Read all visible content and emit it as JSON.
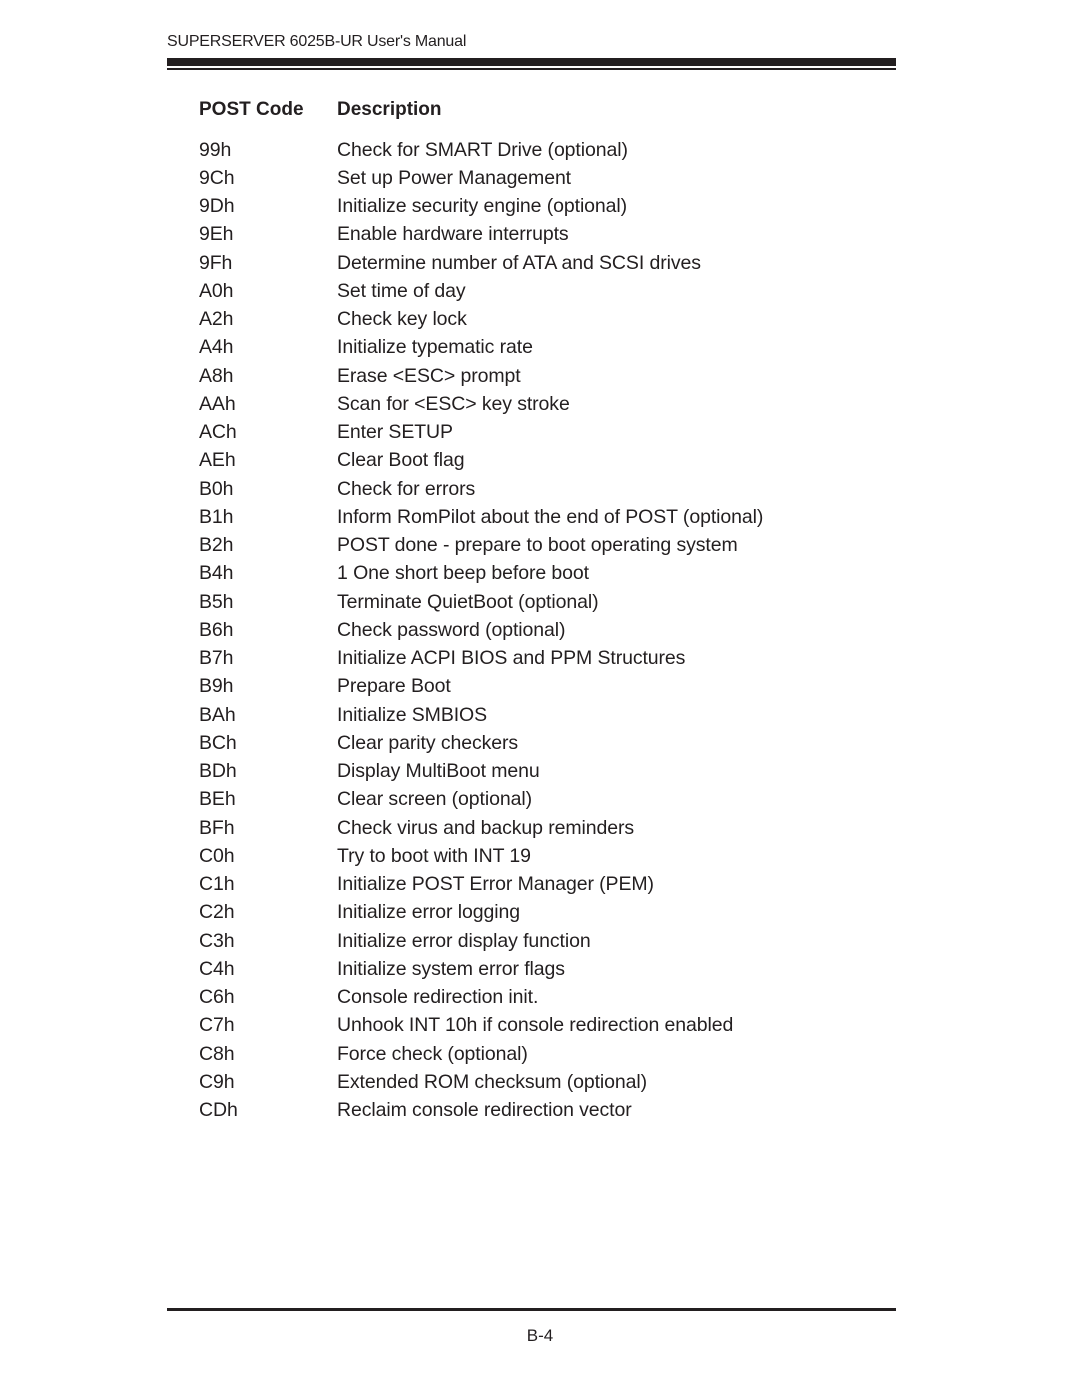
{
  "header": {
    "running_title": "SUPERSERVER 6025B-UR User's Manual"
  },
  "table": {
    "columns": [
      "POST Code",
      "Description"
    ],
    "rows": [
      {
        "code": "99h",
        "description": "Check for SMART Drive (optional)"
      },
      {
        "code": "9Ch",
        "description": "Set up Power Management"
      },
      {
        "code": "9Dh",
        "description": "Initialize security engine (optional)"
      },
      {
        "code": "9Eh",
        "description": "Enable hardware interrupts"
      },
      {
        "code": "9Fh",
        "description": "Determine number of ATA and SCSI drives"
      },
      {
        "code": "A0h",
        "description": "Set time of day"
      },
      {
        "code": "A2h",
        "description": "Check key lock"
      },
      {
        "code": "A4h",
        "description": "Initialize typematic rate"
      },
      {
        "code": "A8h",
        "description": "Erase <ESC> prompt"
      },
      {
        "code": "AAh",
        "description": "Scan for <ESC> key stroke"
      },
      {
        "code": "ACh",
        "description": "Enter SETUP"
      },
      {
        "code": "AEh",
        "description": "Clear Boot flag"
      },
      {
        "code": "B0h",
        "description": "Check for errors"
      },
      {
        "code": "B1h",
        "description": "Inform RomPilot about the end of POST (optional)"
      },
      {
        "code": "B2h",
        "description": "POST done - prepare to boot operating system"
      },
      {
        "code": "B4h",
        "description": "1 One short beep before boot"
      },
      {
        "code": "B5h",
        "description": "Terminate QuietBoot (optional)"
      },
      {
        "code": "B6h",
        "description": "Check password (optional)"
      },
      {
        "code": "B7h",
        "description": "Initialize ACPI BIOS and PPM Structures"
      },
      {
        "code": "B9h",
        "description": "Prepare Boot"
      },
      {
        "code": "BAh",
        "description": "Initialize SMBIOS"
      },
      {
        "code": "BCh",
        "description": "Clear parity checkers"
      },
      {
        "code": "BDh",
        "description": "Display MultiBoot menu"
      },
      {
        "code": "BEh",
        "description": "Clear screen (optional)"
      },
      {
        "code": "BFh",
        "description": "Check virus and backup reminders"
      },
      {
        "code": "C0h",
        "description": "Try to boot with INT 19"
      },
      {
        "code": "C1h",
        "description": "Initialize POST Error Manager (PEM)"
      },
      {
        "code": "C2h",
        "description": "Initialize error logging"
      },
      {
        "code": "C3h",
        "description": "Initialize error display function"
      },
      {
        "code": "C4h",
        "description": "Initialize system error flags"
      },
      {
        "code": "C6h",
        "description": "Console redirection init."
      },
      {
        "code": "C7h",
        "description": "Unhook INT 10h if console redirection enabled"
      },
      {
        "code": "C8h",
        "description": "Force check (optional)"
      },
      {
        "code": "C9h",
        "description": "Extended ROM checksum (optional)"
      },
      {
        "code": "CDh",
        "description": "Reclaim console redirection vector"
      }
    ]
  },
  "footer": {
    "page_number": "B-4"
  }
}
